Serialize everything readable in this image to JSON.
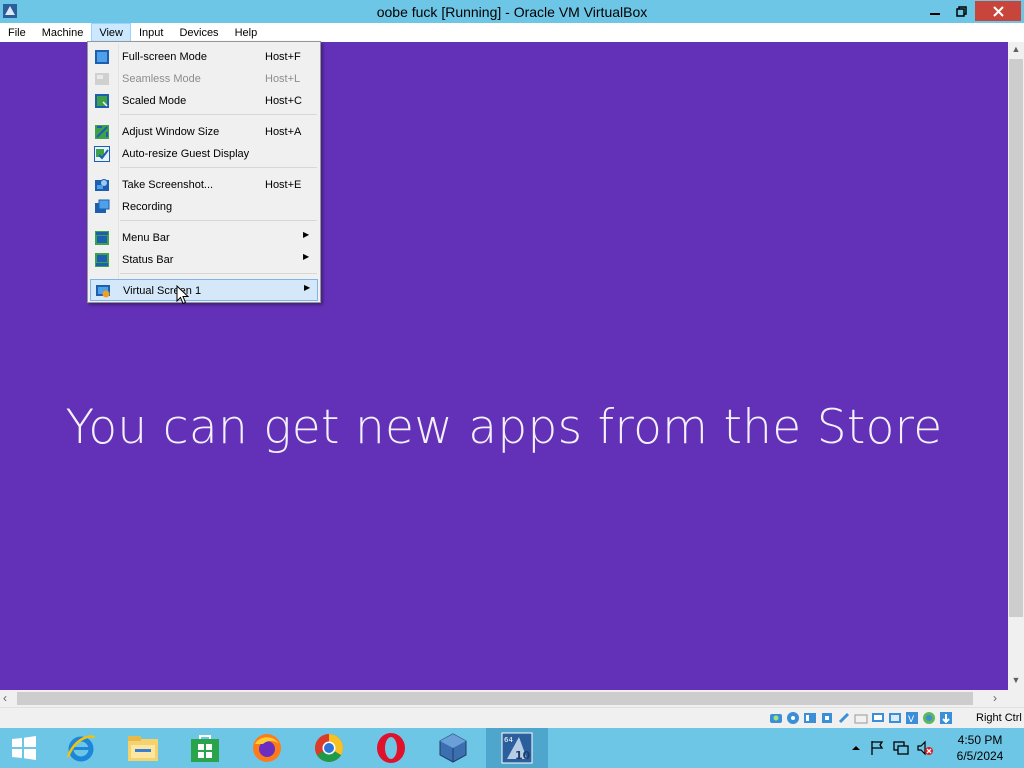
{
  "window": {
    "title": "oobe fuck [Running] - Oracle VM VirtualBox"
  },
  "menubar": {
    "items": [
      {
        "label": "File"
      },
      {
        "label": "Machine"
      },
      {
        "label": "View"
      },
      {
        "label": "Input"
      },
      {
        "label": "Devices"
      },
      {
        "label": "Help"
      }
    ]
  },
  "view_menu": {
    "items": [
      {
        "label": "Full-screen Mode",
        "shortcut": "Host+F",
        "icon": "fullscreen-icon"
      },
      {
        "label": "Seamless Mode",
        "shortcut": "Host+L",
        "icon": "seamless-icon",
        "disabled": true
      },
      {
        "label": "Scaled Mode",
        "shortcut": "Host+C",
        "icon": "scaled-icon"
      },
      {
        "label": "Adjust Window Size",
        "shortcut": "Host+A",
        "icon": "adjust-window-icon"
      },
      {
        "label": "Auto-resize Guest Display",
        "shortcut": "",
        "icon": "auto-resize-icon"
      },
      {
        "label": "Take Screenshot...",
        "shortcut": "Host+E",
        "icon": "screenshot-icon"
      },
      {
        "label": "Recording",
        "shortcut": "",
        "icon": "recording-icon"
      },
      {
        "label": "Menu Bar",
        "shortcut": "",
        "icon": "menubar-icon",
        "submenu": true
      },
      {
        "label": "Status Bar",
        "shortcut": "",
        "icon": "statusbar-icon",
        "submenu": true
      },
      {
        "label": "Virtual Screen 1",
        "shortcut": "",
        "icon": "virtual-screen-icon",
        "submenu": true,
        "highlighted": true
      }
    ]
  },
  "vm": {
    "message": "You can get new apps from the Store"
  },
  "statusbar": {
    "host_key": "Right Ctrl"
  },
  "taskbar": {
    "clock_time": "4:50 PM",
    "clock_date": "6/5/2024",
    "pinned": [
      "start-icon",
      "internet-explorer-icon",
      "file-explorer-icon",
      "store-icon",
      "firefox-icon",
      "chrome-icon",
      "opera-icon",
      "virtualbox-icon",
      "windows10-vm-icon"
    ]
  },
  "colors": {
    "vm_background": "#6231b8",
    "title_bar": "#6ec6e6",
    "close_button": "#c7453a",
    "menu_highlight": "#d5e8f9"
  }
}
